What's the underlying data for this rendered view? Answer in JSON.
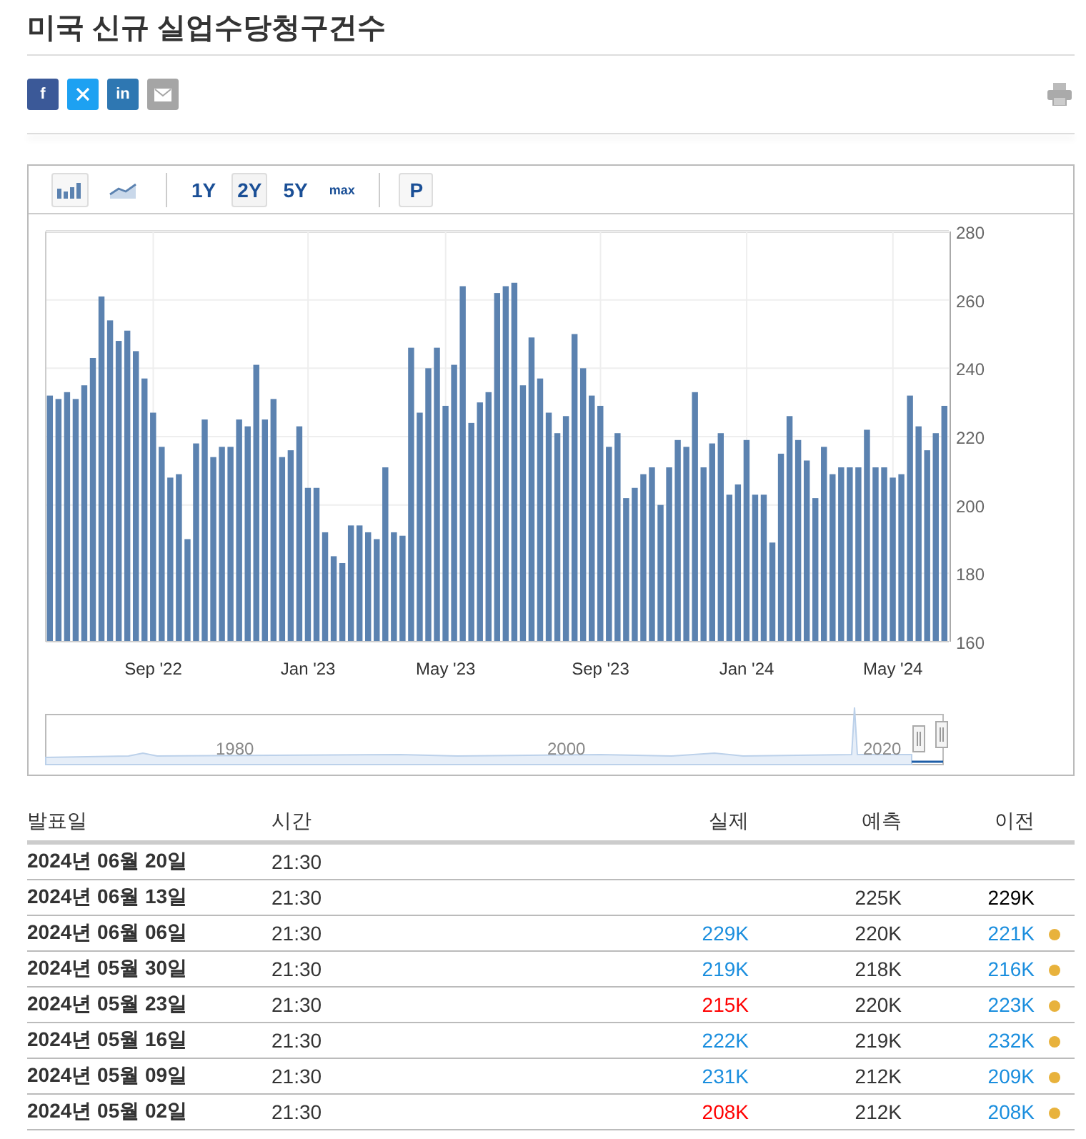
{
  "title": "미국 신규 실업수당청구건수",
  "share": [
    {
      "kind": "facebook",
      "glyph": "f"
    },
    {
      "kind": "x"
    },
    {
      "kind": "linkedin",
      "glyph": "in"
    },
    {
      "kind": "email"
    }
  ],
  "toolbar": {
    "chart_types": [
      {
        "kind": "bar",
        "selected": true
      },
      {
        "kind": "line",
        "selected": false
      }
    ],
    "ranges": [
      {
        "label": "1Y",
        "selected": false
      },
      {
        "label": "2Y",
        "selected": true
      },
      {
        "label": "5Y",
        "selected": false
      },
      {
        "label": "max",
        "selected": false
      }
    ],
    "p_button": "P"
  },
  "chart": {
    "chart_data": {
      "type": "bar",
      "grid": true,
      "ylim": [
        160,
        280
      ],
      "yticks": [
        160,
        180,
        200,
        220,
        240,
        260,
        280
      ],
      "categories": [
        null,
        null,
        null,
        null,
        null,
        null,
        null,
        null,
        null,
        null,
        null,
        null,
        "Sep '22",
        null,
        null,
        null,
        null,
        null,
        null,
        null,
        null,
        null,
        null,
        null,
        null,
        null,
        null,
        null,
        null,
        null,
        "Jan '23",
        null,
        null,
        null,
        null,
        null,
        null,
        null,
        null,
        null,
        null,
        null,
        null,
        null,
        null,
        null,
        "May '23",
        null,
        null,
        null,
        null,
        null,
        null,
        null,
        null,
        null,
        null,
        null,
        null,
        null,
        null,
        null,
        null,
        null,
        "Sep '23",
        null,
        null,
        null,
        null,
        null,
        null,
        null,
        null,
        null,
        null,
        null,
        null,
        null,
        null,
        null,
        null,
        "Jan '24",
        null,
        null,
        null,
        null,
        null,
        null,
        null,
        null,
        null,
        null,
        null,
        null,
        null,
        null,
        null,
        null,
        "May '24",
        null,
        null,
        null,
        null,
        null,
        null
      ],
      "series": [
        {
          "color": "#5b82b0",
          "values": [
            232,
            231,
            233,
            231,
            235,
            243,
            261,
            254,
            248,
            251,
            245,
            237,
            227,
            217,
            208,
            209,
            190,
            218,
            225,
            214,
            217,
            217,
            225,
            223,
            241,
            225,
            231,
            214,
            216,
            223,
            205,
            205,
            192,
            185,
            183,
            194,
            194,
            192,
            190,
            211,
            192,
            191,
            246,
            227,
            240,
            246,
            229,
            241,
            264,
            224,
            230,
            233,
            262,
            264,
            265,
            235,
            249,
            237,
            227,
            221,
            226,
            250,
            240,
            232,
            229,
            217,
            221,
            202,
            205,
            209,
            211,
            200,
            211,
            219,
            217,
            233,
            211,
            218,
            221,
            203,
            206,
            219,
            203,
            203,
            189,
            215,
            226,
            219,
            213,
            202,
            217,
            209,
            211,
            211,
            211,
            222,
            211,
            211,
            208,
            209,
            232,
            223,
            216,
            221,
            229
          ]
        }
      ]
    },
    "navigator_labels": [
      "1980",
      "2000",
      "2020"
    ]
  },
  "table": {
    "columns": [
      "발표일",
      "시간",
      "실제",
      "예측",
      "이전"
    ],
    "rows": [
      {
        "date": "2024년 06월 20일",
        "time": "21:30",
        "revised": false
      },
      {
        "date": "2024년 06월 13일",
        "time": "21:30",
        "forecast": "225K",
        "previous": {
          "text": "229K",
          "color": "#000000"
        },
        "revised": false
      },
      {
        "date": "2024년 06월 06일",
        "time": "21:30",
        "actual": {
          "text": "229K",
          "color": "#1a8ede"
        },
        "forecast": "220K",
        "previous": {
          "text": "221K",
          "color": "#1a8ede"
        },
        "revised": true
      },
      {
        "date": "2024년 05월 30일",
        "time": "21:30",
        "actual": {
          "text": "219K",
          "color": "#1a8ede"
        },
        "forecast": "218K",
        "previous": {
          "text": "216K",
          "color": "#1a8ede"
        },
        "revised": true
      },
      {
        "date": "2024년 05월 23일",
        "time": "21:30",
        "actual": {
          "text": "215K",
          "color": "#ff0000"
        },
        "forecast": "220K",
        "previous": {
          "text": "223K",
          "color": "#1a8ede"
        },
        "revised": true
      },
      {
        "date": "2024년 05월 16일",
        "time": "21:30",
        "actual": {
          "text": "222K",
          "color": "#1a8ede"
        },
        "forecast": "219K",
        "previous": {
          "text": "232K",
          "color": "#1a8ede"
        },
        "revised": true
      },
      {
        "date": "2024년 05월 09일",
        "time": "21:30",
        "actual": {
          "text": "231K",
          "color": "#1a8ede"
        },
        "forecast": "212K",
        "previous": {
          "text": "209K",
          "color": "#1a8ede"
        },
        "revised": true
      },
      {
        "date": "2024년 05월 02일",
        "time": "21:30",
        "actual": {
          "text": "208K",
          "color": "#ff0000"
        },
        "forecast": "212K",
        "previous": {
          "text": "208K",
          "color": "#1a8ede"
        },
        "revised": true
      }
    ]
  }
}
